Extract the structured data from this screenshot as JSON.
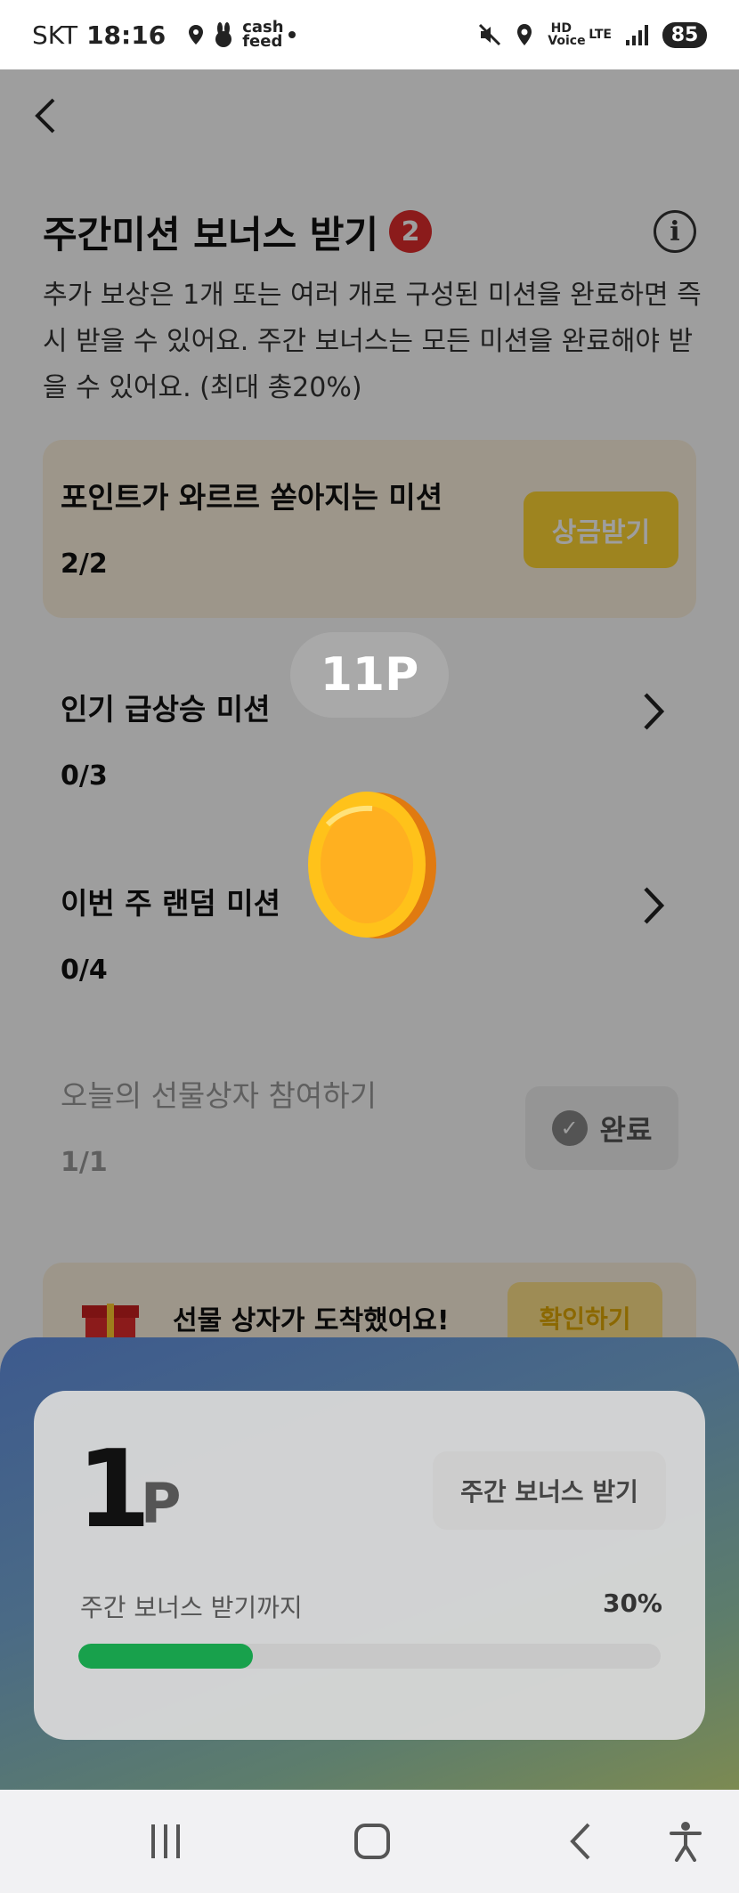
{
  "status_bar": {
    "carrier": "SKT",
    "time": "18:16",
    "cash_feed": "cash feed",
    "hd_voice": "HD Voice",
    "network": "LTE",
    "battery": "85"
  },
  "header": {
    "title": "주간미션 보너스 받기",
    "badge_count": "2",
    "info_icon": "i",
    "description": "추가 보상은 1개 또는 여러 개로 구성된 미션을 완료하면 즉시 받을 수 있어요. 주간 보너스는 모든 미션을 완료해야 받을 수 있어요. (최대 총20%)"
  },
  "missions": [
    {
      "name": "포인트가 와르르 쏟아지는 미션",
      "progress": "2/2",
      "action": "상금받기"
    },
    {
      "name": "인기 급상승 미션",
      "progress": "0/3"
    },
    {
      "name": "이번 주 랜덤 미션",
      "progress": "0/4"
    },
    {
      "name": "오늘의 선물상자 참여하기",
      "progress": "1/1",
      "action": "완료"
    }
  ],
  "gift_banner": {
    "text": "선물 상자가 도착했어요!",
    "button": "확인하기"
  },
  "reward_popup": {
    "points_label": "11P"
  },
  "bottom_sheet": {
    "points_value": "1",
    "points_unit": "P",
    "weekly_button": "주간 보너스 받기",
    "progress_label": "주간 보너스 받기까지",
    "progress_percent_label": "30%",
    "progress_fraction": 0.3
  },
  "colors": {
    "accent_yellow": "#ffd633",
    "badge_red": "#e02d2d",
    "progress_green": "#18a14c"
  },
  "nav_icons": [
    "recents-icon",
    "home-icon",
    "back-icon",
    "accessibility-icon"
  ]
}
